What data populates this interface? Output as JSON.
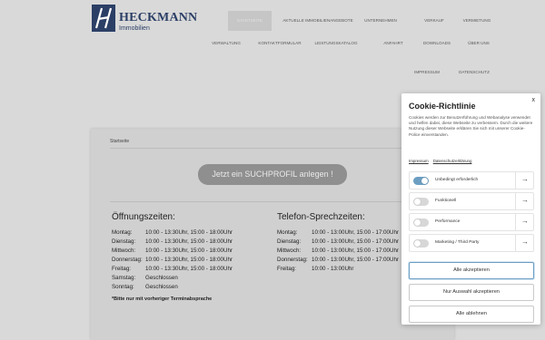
{
  "brand": {
    "name": "HECKMANN",
    "sub": "Immobilien"
  },
  "nav": [
    "Startseite",
    "Aktuelle Immobilienangebote",
    "Unternehmen",
    "Verkauf",
    "Vermietung",
    "Verwaltung",
    "Kontaktformular",
    "Leistungskatalog",
    "Anfahrt",
    "Downloads",
    "Über uns",
    "Impressum",
    "Datenschutz"
  ],
  "breadcrumb": "Startseite",
  "cta_label": "Jetzt ein SUCHPROFIL anlegen !",
  "hours": {
    "title": "Öffnungszeiten:",
    "rows": [
      {
        "day": "Montag:",
        "time": "10:00 - 13:30Uhr, 15:00 - 18:00Uhr"
      },
      {
        "day": "Dienstag:",
        "time": "10:00 - 13:30Uhr, 15:00 - 18:00Uhr"
      },
      {
        "day": "Mittwoch:",
        "time": "10:00 - 13:30Uhr, 15:00 - 18:00Uhr"
      },
      {
        "day": "Donnerstag:",
        "time": "10:00 - 13:30Uhr, 15:00 - 18:00Uhr"
      },
      {
        "day": "Freitag:",
        "time": "10:00 - 13:30Uhr, 15:00 - 18:00Uhr"
      },
      {
        "day": "Samstag:",
        "time": "Geschlossen"
      },
      {
        "day": "Sonntag:",
        "time": "Geschlossen"
      }
    ],
    "note": "*Bitte nur mit vorheriger Terminabsprache"
  },
  "phone": {
    "title": "Telefon-Sprechzeiten:",
    "rows": [
      {
        "day": "Montag:",
        "time": "10:00 - 13:00Uhr, 15:00 - 17:00Uhr"
      },
      {
        "day": "Dienstag:",
        "time": "10:00 - 13:00Uhr, 15:00 - 17:00Uhr"
      },
      {
        "day": "Mittwoch:",
        "time": "10:00 - 13:00Uhr, 15:00 - 17:00Uhr"
      },
      {
        "day": "Donnerstag:",
        "time": "10:00 - 13:00Uhr, 15:00 - 17:00Uhr"
      },
      {
        "day": "Freitag:",
        "time": "10:00 - 13:00Uhr"
      }
    ]
  },
  "cookie": {
    "close": "x",
    "title": "Cookie-Richtlinie",
    "text": "Cookies werden zur Benutzerführung und Webanalyse verwendet und helfen dabei, diese Webseite zu verbessern. Durch die weitere Nutzung dieser Webseite erklären Sie sich mit unserer Cookie-Police einverstanden.",
    "link_imprint": "Impressum",
    "link_privacy": "Datenschutzerklärung",
    "categories": [
      {
        "label": "Unbedingt erforderlich",
        "enabled": true
      },
      {
        "label": "Funktionell",
        "enabled": false
      },
      {
        "label": "Performance",
        "enabled": false
      },
      {
        "label": "Marketing / Third Party",
        "enabled": false
      }
    ],
    "accept_all": "Alle akzeptieren",
    "accept_selection": "Nur Auswahl akzeptieren",
    "reject_all": "Alle ablehnen"
  },
  "colors": {
    "brand": "#2b3f66",
    "toggle_on": "#6c9ec2",
    "cta_bg": "#8f8f8f"
  }
}
